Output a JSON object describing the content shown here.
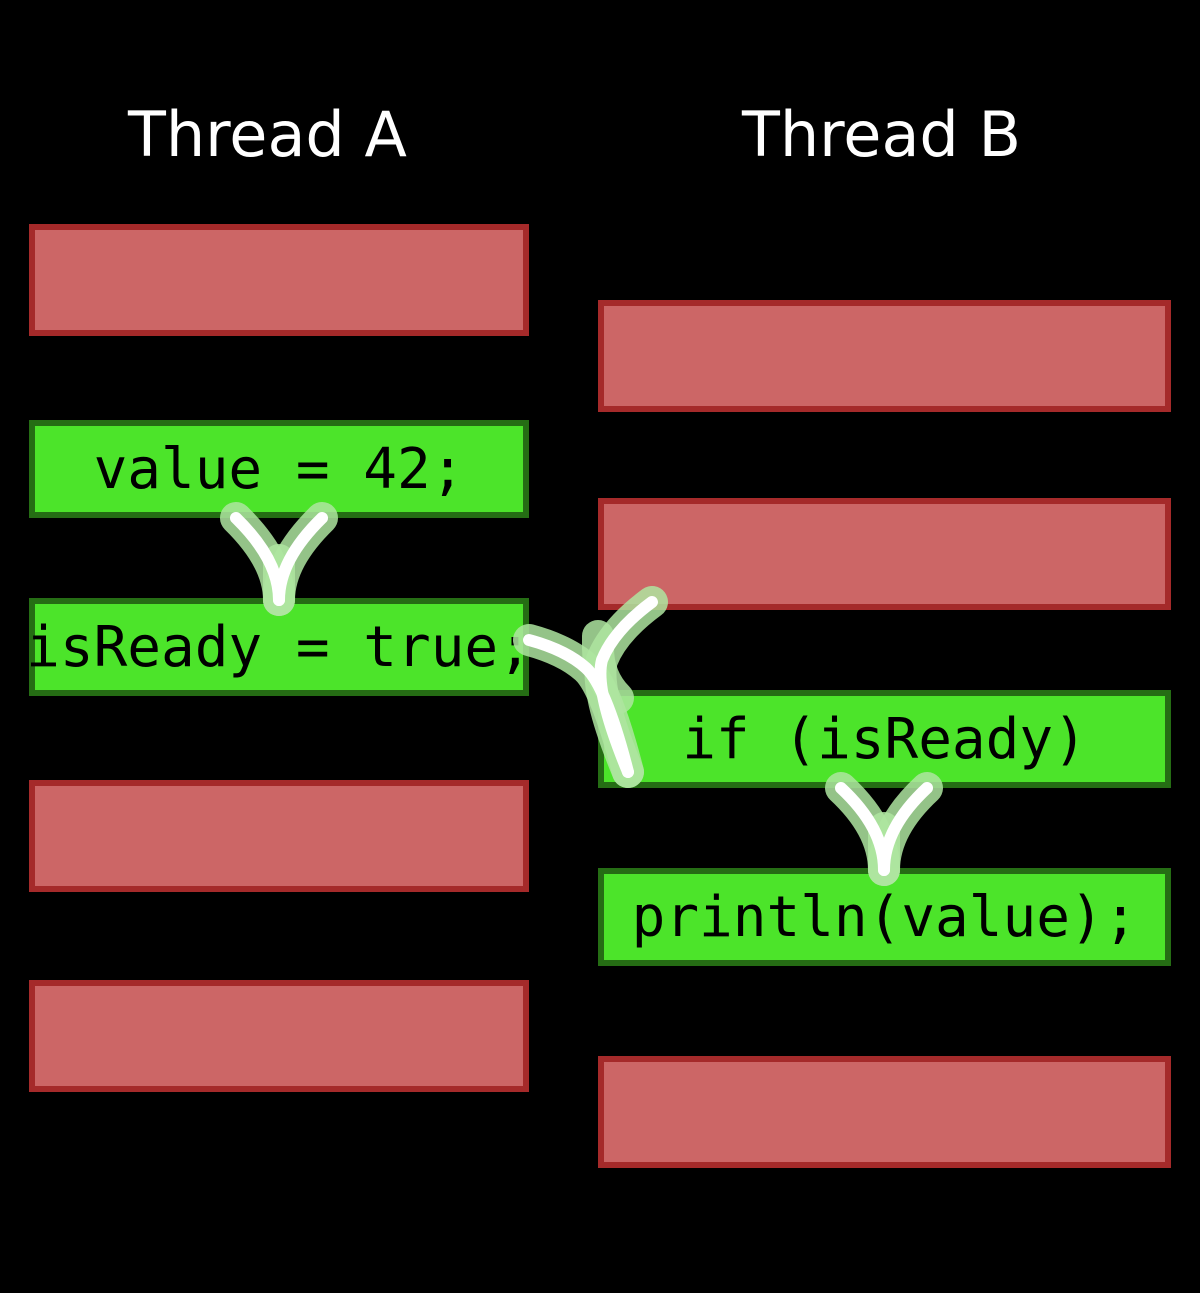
{
  "threads": {
    "a": {
      "title": "Thread A"
    },
    "b": {
      "title": "Thread B"
    }
  },
  "code": {
    "assign_value": "value = 42;",
    "assign_isready": "isReady = true;",
    "check_isready": "if (isReady)",
    "print_value": "println(value);"
  },
  "colors": {
    "background": "#000000",
    "text": "#FFFFFF",
    "red_fill": "#CC6666",
    "red_border": "#A52A2A",
    "green_fill": "#4CE42A",
    "green_border": "#256D14"
  }
}
